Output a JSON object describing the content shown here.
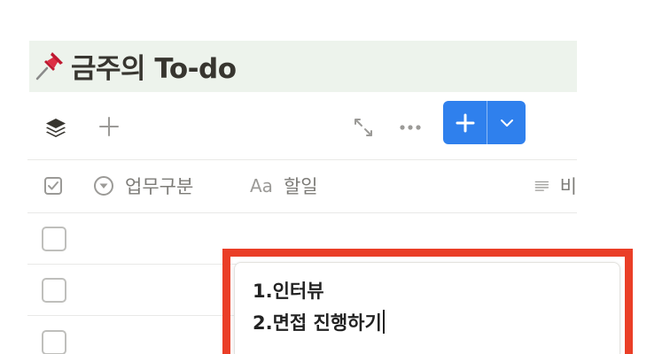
{
  "page": {
    "title": "금주의 To-do"
  },
  "toolbar": {
    "new_button_plus": "+",
    "icons": [
      "layers-icon",
      "plus-icon",
      "expand-icon",
      "more-icon",
      "plus-icon",
      "chevron-down-icon"
    ]
  },
  "table": {
    "columns": [
      {
        "label": "",
        "icon": "checkbox-icon"
      },
      {
        "label": "업무구분",
        "icon": "select-icon"
      },
      {
        "label": "할일",
        "icon": "text-type-icon",
        "prefix": "Aa"
      },
      {
        "label": "비",
        "icon": "lines-icon"
      }
    ],
    "rows": [
      {
        "checked": false
      },
      {
        "checked": false
      },
      {
        "checked": false
      }
    ]
  },
  "editor": {
    "lines": [
      "1.인터뷰",
      "2.면접 진행하기"
    ]
  },
  "colors": {
    "header_band": "#edf3ec",
    "accent_blue": "#2f80ed",
    "highlight_red": "#ea3e27"
  }
}
